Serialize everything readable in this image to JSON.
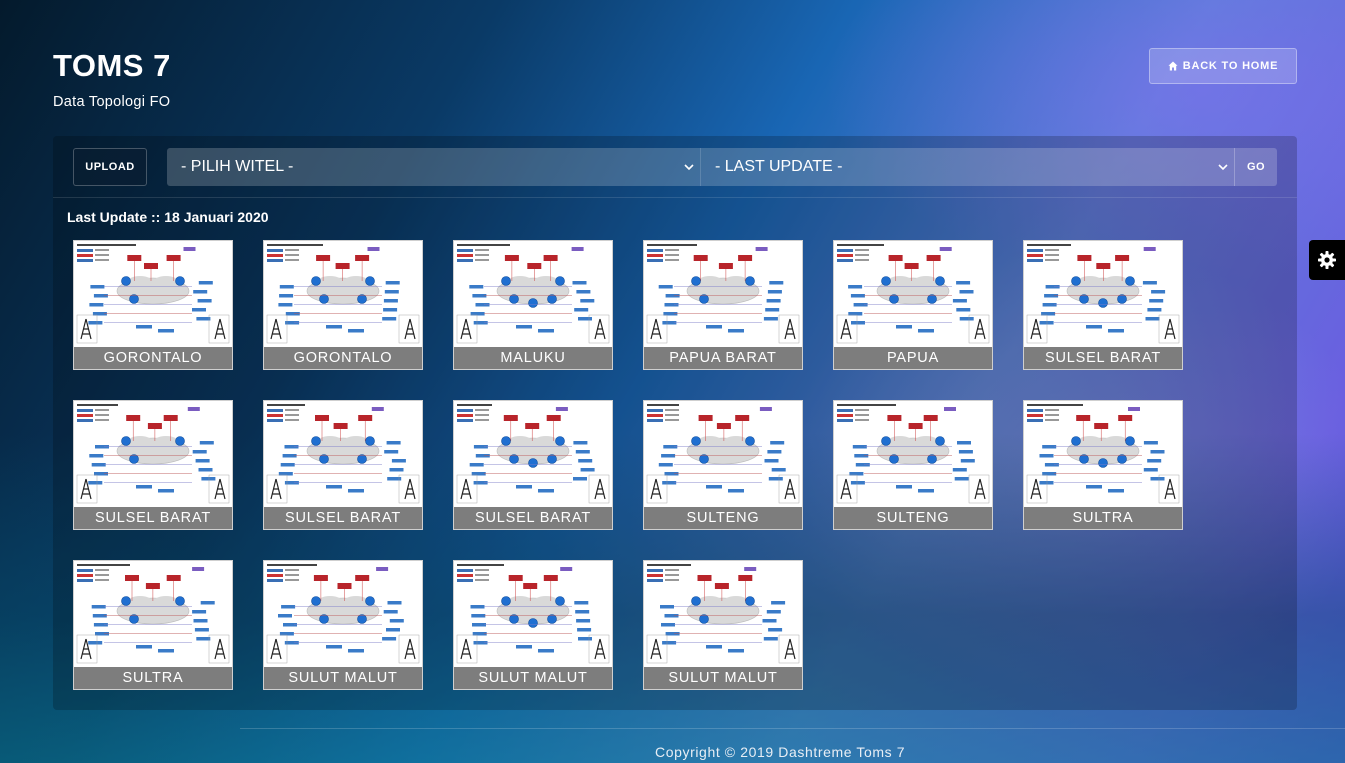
{
  "page": {
    "title": "TOMS 7",
    "subtitle": "Data Topologi FO"
  },
  "nav": {
    "back_label": "BACK TO HOME",
    "back_icon": "home-icon"
  },
  "settings": {
    "icon": "gear-icon"
  },
  "toolbar": {
    "upload_label": "UPLOAD",
    "witel_selected": "- PILIH WITEL -",
    "update_selected": "- LAST UPDATE -",
    "go_label": "GO"
  },
  "last_update": "Last Update :: 18 Januari 2020",
  "tiles": [
    {
      "label": "GORONTALO"
    },
    {
      "label": "GORONTALO"
    },
    {
      "label": "MALUKU"
    },
    {
      "label": "PAPUA BARAT"
    },
    {
      "label": "PAPUA"
    },
    {
      "label": "SULSEL BARAT"
    },
    {
      "label": "SULSEL BARAT"
    },
    {
      "label": "SULSEL BARAT"
    },
    {
      "label": "SULSEL BARAT"
    },
    {
      "label": "SULTENG"
    },
    {
      "label": "SULTENG"
    },
    {
      "label": "SULTRA"
    },
    {
      "label": "SULTRA"
    },
    {
      "label": "SULUT MALUT"
    },
    {
      "label": "SULUT MALUT"
    },
    {
      "label": "SULUT MALUT"
    }
  ],
  "footer": {
    "copyright": "Copyright © 2019 Dashtreme Toms 7"
  }
}
